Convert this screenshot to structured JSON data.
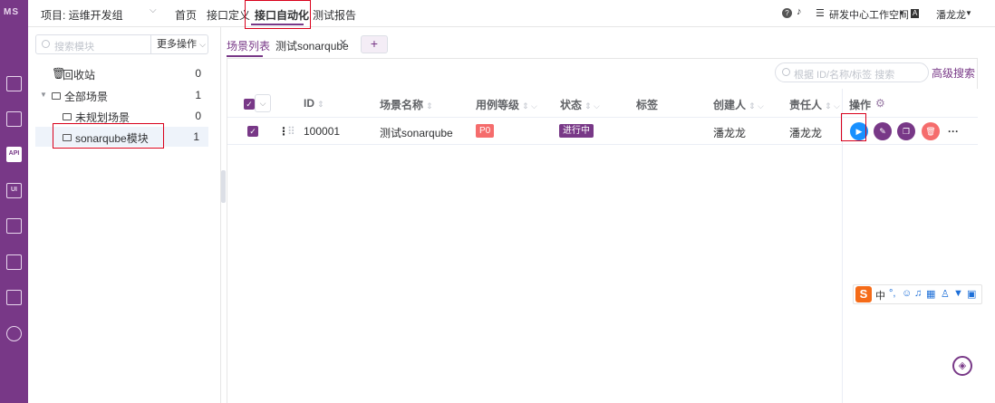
{
  "rail": {
    "logo": "MS",
    "items": [
      {
        "name": "workbench",
        "icon": "monitor-icon",
        "glyph": ""
      },
      {
        "name": "track",
        "icon": "clipboard-icon",
        "glyph": ""
      },
      {
        "name": "api",
        "icon": "api-icon",
        "glyph": "API"
      },
      {
        "name": "ui",
        "icon": "ui-icon",
        "glyph": "UI"
      },
      {
        "name": "performance",
        "icon": "chart-icon",
        "glyph": ""
      },
      {
        "name": "report",
        "icon": "report-icon",
        "glyph": ""
      },
      {
        "name": "project",
        "icon": "folder-icon",
        "glyph": ""
      },
      {
        "name": "settings",
        "icon": "gear-icon",
        "glyph": ""
      }
    ]
  },
  "topbar": {
    "project_label": "项目: 运维开发组",
    "nav": [
      "首页",
      "接口定义",
      "接口自动化",
      "测试报告"
    ],
    "workspace": "研发中心工作空间",
    "lang": "A",
    "user": "潘龙龙"
  },
  "tree": {
    "search_placeholder": "搜索模块",
    "more_actions": "更多操作",
    "recycle": {
      "label": "回收站",
      "count": "0"
    },
    "all": {
      "label": "全部场景",
      "count": "1"
    },
    "unplanned": {
      "label": "未规划场景",
      "count": "0"
    },
    "module": {
      "label": "sonarqube模块",
      "count": "1"
    }
  },
  "tabs": {
    "list": "场景列表",
    "scenario": "测试sonarqube",
    "add": "+"
  },
  "table": {
    "search_placeholder": "根据 ID/名称/标签 搜索",
    "advanced": "高级搜索",
    "headers": {
      "id": "ID",
      "name": "场景名称",
      "level": "用例等级",
      "status": "状态",
      "tags": "标签",
      "creator": "创建人",
      "owner": "责任人",
      "ops": "操作"
    },
    "rows": [
      {
        "id": "100001",
        "name": "测试sonarqube",
        "level": "P0",
        "status": "进行中",
        "tags": "",
        "creator": "潘龙龙",
        "owner": "潘龙龙"
      }
    ]
  },
  "ime": {
    "logo": "S",
    "lang": "中"
  },
  "colors": {
    "brand": "#783887",
    "accent": "#d9001b",
    "run": "#1890ff",
    "danger": "#f56c6c",
    "badge_p0": "#f56c6c"
  }
}
